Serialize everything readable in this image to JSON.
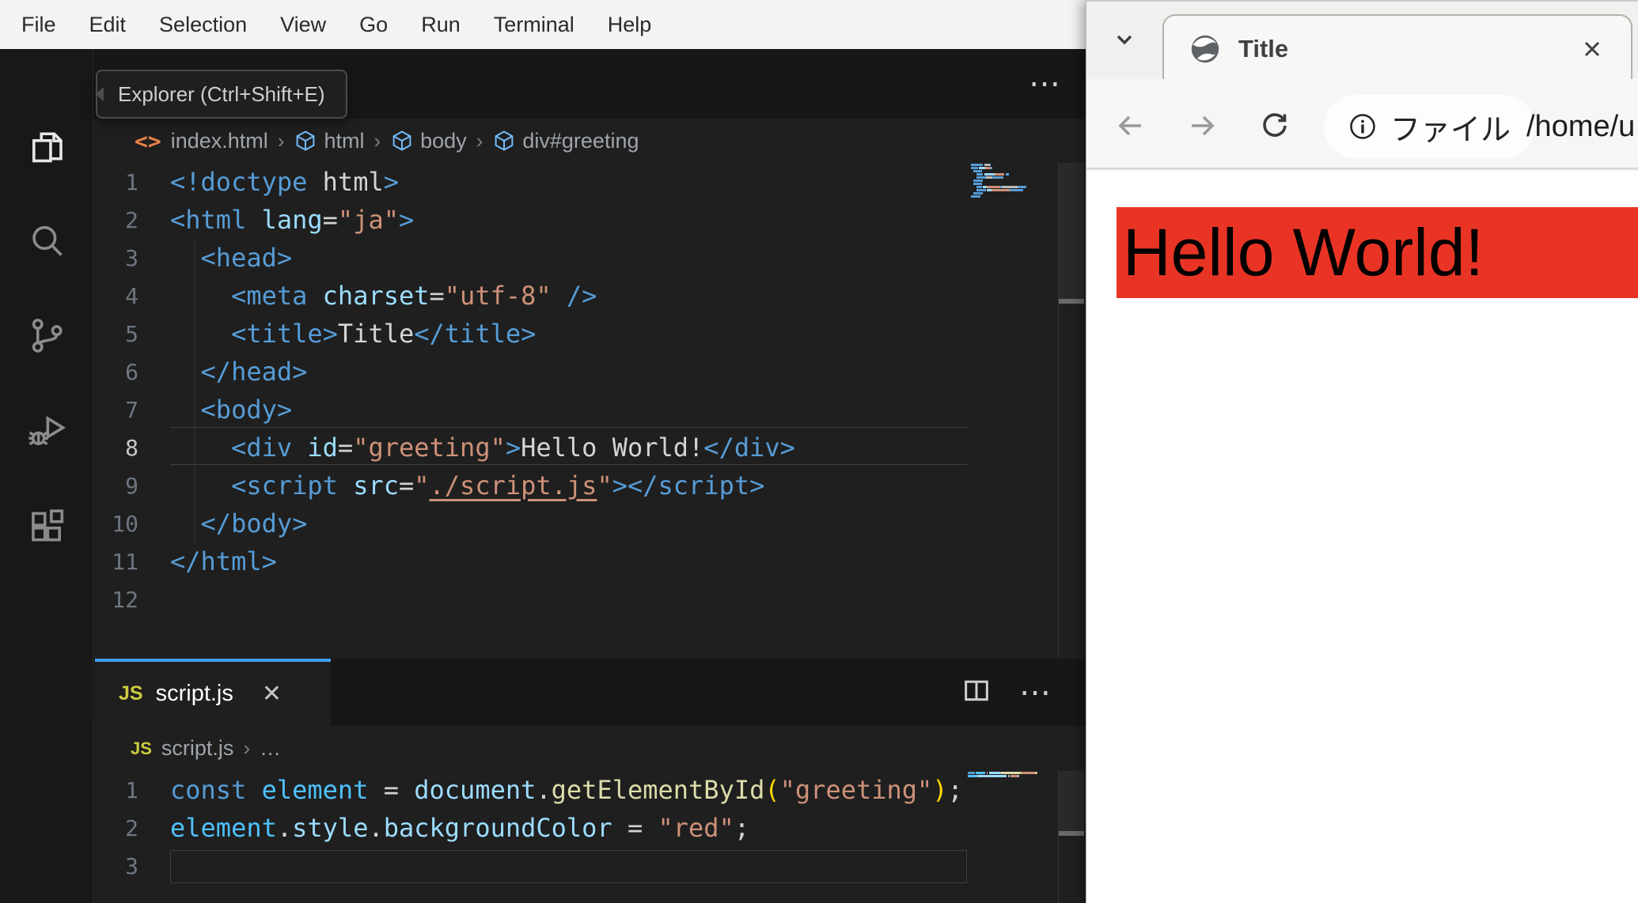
{
  "menu_bar": {
    "items": [
      "File",
      "Edit",
      "Selection",
      "View",
      "Go",
      "Run",
      "Terminal",
      "Help"
    ]
  },
  "activity_bar": {
    "icons": [
      {
        "name": "explorer",
        "active": true
      },
      {
        "name": "search",
        "active": false
      },
      {
        "name": "source-control",
        "active": false
      },
      {
        "name": "run-and-debug",
        "active": false
      },
      {
        "name": "extensions",
        "active": false
      }
    ]
  },
  "tooltip": {
    "text": "Explorer (Ctrl+Shift+E)"
  },
  "html_editor": {
    "actions": {
      "more": "⋯"
    },
    "breadcrumb": {
      "file": "index.html",
      "segments": [
        "html",
        "body",
        "div#greeting"
      ],
      "separator": "›"
    },
    "active_line": 8,
    "lines": [
      {
        "n": "1",
        "tokens": [
          [
            "<!doctype",
            "t"
          ],
          [
            " ",
            "x"
          ],
          [
            "html",
            "x"
          ],
          [
            ">",
            "t"
          ]
        ]
      },
      {
        "n": "2",
        "tokens": [
          [
            "<html",
            "t"
          ],
          [
            " ",
            "x"
          ],
          [
            "lang",
            "a"
          ],
          [
            "=",
            "x"
          ],
          [
            "\"ja\"",
            "s"
          ],
          [
            ">",
            "t"
          ]
        ]
      },
      {
        "n": "3",
        "tokens": [
          [
            "  ",
            "x"
          ],
          [
            "<head>",
            "t"
          ]
        ]
      },
      {
        "n": "4",
        "tokens": [
          [
            "    ",
            "x"
          ],
          [
            "<meta",
            "t"
          ],
          [
            " ",
            "x"
          ],
          [
            "charset",
            "a"
          ],
          [
            "=",
            "x"
          ],
          [
            "\"utf-8\"",
            "s"
          ],
          [
            " ",
            "x"
          ],
          [
            "/>",
            "t"
          ]
        ]
      },
      {
        "n": "5",
        "tokens": [
          [
            "    ",
            "x"
          ],
          [
            "<title>",
            "t"
          ],
          [
            "Title",
            "x"
          ],
          [
            "</title>",
            "t"
          ]
        ]
      },
      {
        "n": "6",
        "tokens": [
          [
            "  ",
            "x"
          ],
          [
            "</head>",
            "t"
          ]
        ]
      },
      {
        "n": "7",
        "tokens": [
          [
            "  ",
            "x"
          ],
          [
            "<body>",
            "t"
          ]
        ]
      },
      {
        "n": "8",
        "tokens": [
          [
            "    ",
            "x"
          ],
          [
            "<div",
            "t"
          ],
          [
            " ",
            "x"
          ],
          [
            "id",
            "a"
          ],
          [
            "=",
            "x"
          ],
          [
            "\"greeting\"",
            "s"
          ],
          [
            ">",
            "t"
          ],
          [
            "Hello World!",
            "x"
          ],
          [
            "</div>",
            "t"
          ]
        ]
      },
      {
        "n": "9",
        "tokens": [
          [
            "    ",
            "x"
          ],
          [
            "<script",
            "t"
          ],
          [
            " ",
            "x"
          ],
          [
            "src",
            "a"
          ],
          [
            "=",
            "x"
          ],
          [
            "\"",
            "s"
          ],
          [
            "./script.js",
            "u"
          ],
          [
            "\"",
            "s"
          ],
          [
            ">",
            "t"
          ],
          [
            "</",
            "t"
          ],
          [
            "script>",
            "t"
          ]
        ]
      },
      {
        "n": "10",
        "tokens": [
          [
            "  ",
            "x"
          ],
          [
            "</body>",
            "t"
          ]
        ]
      },
      {
        "n": "11",
        "tokens": [
          [
            "</html>",
            "t"
          ]
        ]
      },
      {
        "n": "12",
        "tokens": []
      }
    ]
  },
  "js_editor": {
    "tab": {
      "label": "script.js",
      "badge": "JS",
      "close": "✕"
    },
    "actions": {
      "more": "⋯"
    },
    "breadcrumb": {
      "file": "script.js",
      "separator": "›",
      "more": "…",
      "badge": "JS"
    },
    "active_line": 3,
    "lines": [
      {
        "n": "1",
        "tokens": [
          [
            "const",
            "t"
          ],
          [
            " ",
            "x"
          ],
          [
            "element",
            "v"
          ],
          [
            " ",
            "x"
          ],
          [
            "=",
            "x"
          ],
          [
            " ",
            "x"
          ],
          [
            "document",
            "a"
          ],
          [
            ".",
            "x"
          ],
          [
            "getElementById",
            "f"
          ],
          [
            "(",
            "b"
          ],
          [
            "\"greeting\"",
            "s"
          ],
          [
            ")",
            "b"
          ],
          [
            ";",
            "x"
          ]
        ]
      },
      {
        "n": "2",
        "tokens": [
          [
            "element",
            "v"
          ],
          [
            ".",
            "x"
          ],
          [
            "style",
            "a"
          ],
          [
            ".",
            "x"
          ],
          [
            "backgroundColor",
            "a"
          ],
          [
            " ",
            "x"
          ],
          [
            "=",
            "x"
          ],
          [
            " ",
            "x"
          ],
          [
            "\"red\"",
            "s"
          ],
          [
            ";",
            "x"
          ]
        ]
      },
      {
        "n": "3",
        "tokens": []
      }
    ]
  },
  "browser": {
    "tab": {
      "title": "Title"
    },
    "toolbar": {
      "chip_label": "ファイル",
      "url": "/home/u"
    },
    "page": {
      "text": "Hello World!",
      "bg": "#e93425",
      "text_color": "#000000"
    }
  },
  "colors": {
    "menu_bg": "#f4f3f2",
    "editor_bg": "#1f1f1f",
    "strip_bg": "#171717",
    "tab_accent": "#3ea0f4",
    "tag": "#569cd6",
    "attr": "#9cdcfe",
    "string": "#ce9178",
    "func": "#dcdcaa",
    "var": "#4fc1ff",
    "red_banner": "#e93425"
  }
}
